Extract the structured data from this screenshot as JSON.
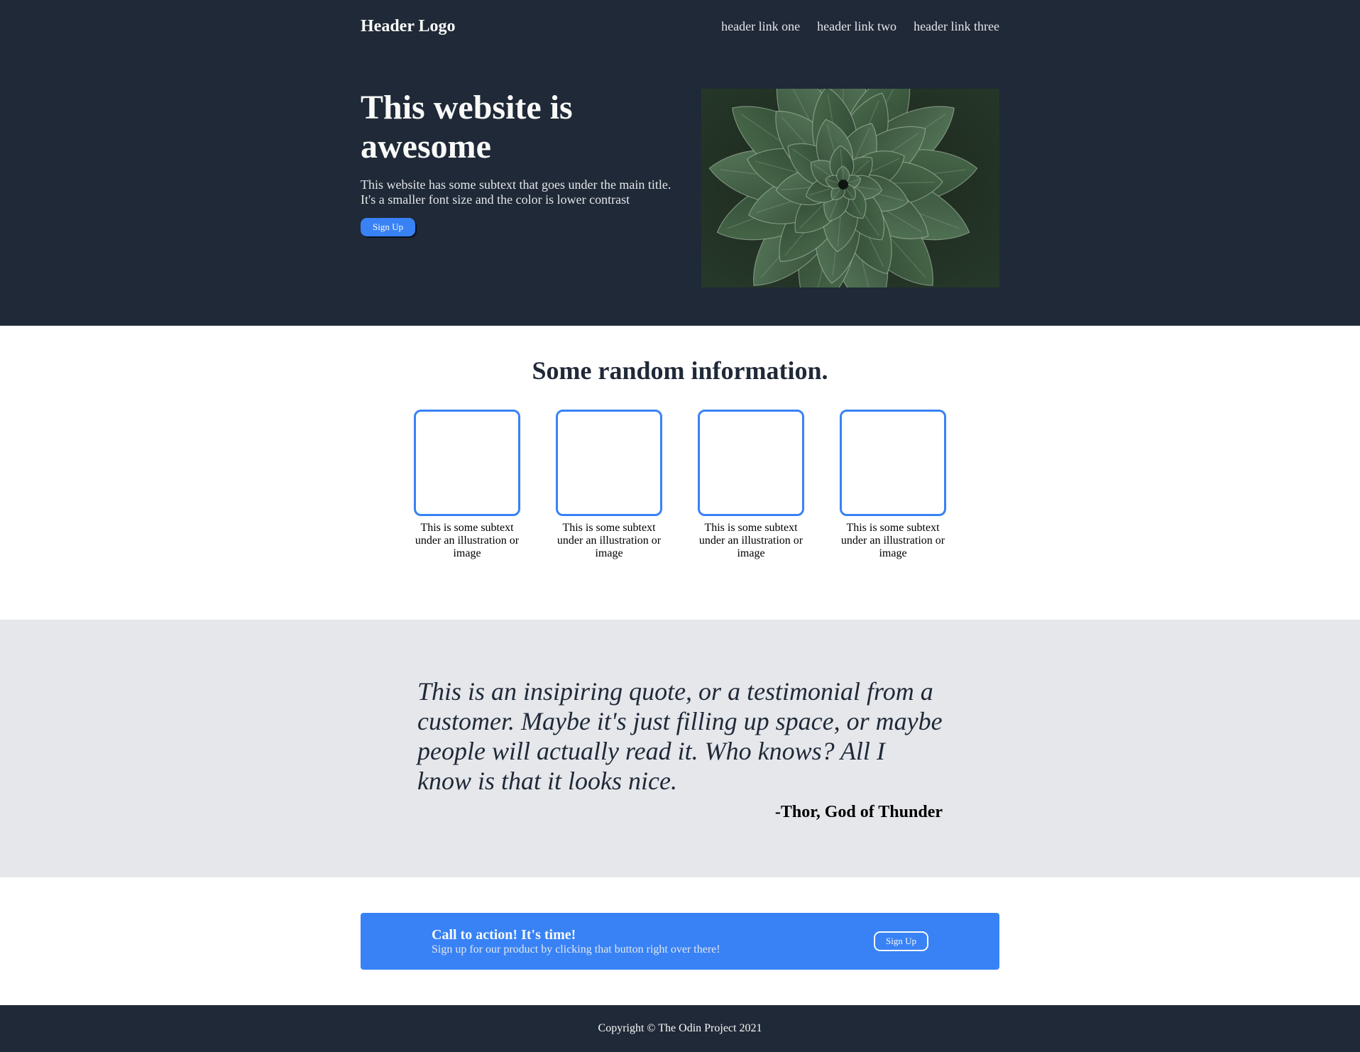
{
  "header": {
    "logo": "Header Logo",
    "links": [
      "header link one",
      "header link two",
      "header link three"
    ]
  },
  "hero": {
    "title": "This website is awesome",
    "subtext": "This website has some subtext that goes under the main title. It's a smaller font size and the color is lower contrast",
    "button_label": "Sign Up",
    "image_alt": "Close-up photo of a green succulent plant"
  },
  "info": {
    "title": "Some random information.",
    "cards": [
      {
        "text": "This is some subtext under an illustration or image"
      },
      {
        "text": "This is some subtext under an illustration or image"
      },
      {
        "text": "This is some subtext under an illustration or image"
      },
      {
        "text": "This is some subtext under an illustration or image"
      }
    ]
  },
  "quote": {
    "text": "This is an insipiring quote, or a testimonial from a customer. Maybe it's just filling up space, or maybe people will actually read it. Who knows? All I know is that it looks nice.",
    "author": "-Thor, God of Thunder"
  },
  "cta": {
    "title": "Call to action! It's time!",
    "subtext": "Sign up for our product by clicking that button right over there!",
    "button_label": "Sign Up"
  },
  "footer": {
    "copyright": "Copyright © The Odin Project 2021"
  },
  "colors": {
    "dark": "#1f2937",
    "accent": "#3882f6",
    "light_text": "#f9faf8",
    "muted_text": "#e5e7eb",
    "quote_bg": "#e5e7eb"
  }
}
